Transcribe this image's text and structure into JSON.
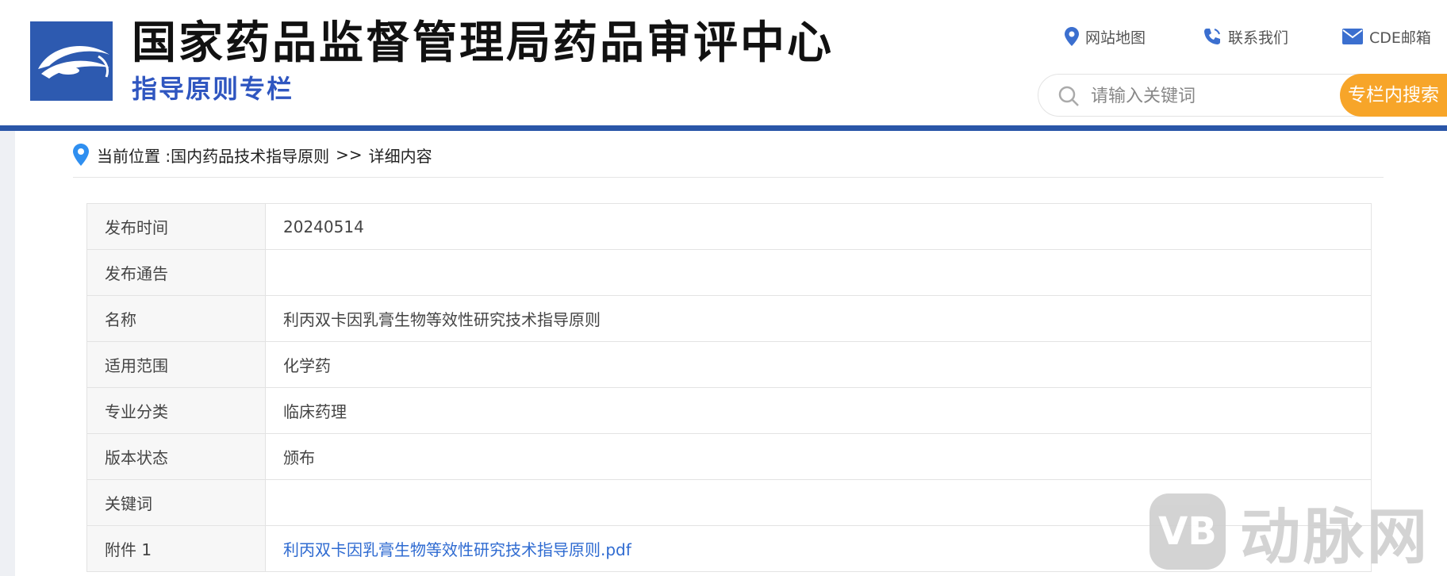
{
  "header": {
    "title": "国家药品监督管理局药品审评中心",
    "subtitle": "指导原则专栏",
    "links": [
      {
        "label": "网站地图",
        "icon": "map-pin-icon"
      },
      {
        "label": "联系我们",
        "icon": "phone-icon"
      },
      {
        "label": "CDE邮箱",
        "icon": "mail-icon"
      }
    ],
    "search": {
      "placeholder": "请输入关键词",
      "button_label": "专栏内搜索"
    }
  },
  "breadcrumb": {
    "prefix": "当前位置 : ",
    "items": [
      "国内药品技术指导原则",
      "详细内容"
    ],
    "separator": ">>"
  },
  "detail_table": [
    {
      "label": "发布时间",
      "value": "20240514"
    },
    {
      "label": "发布通告",
      "value": ""
    },
    {
      "label": "名称",
      "value": "利丙双卡因乳膏生物等效性研究技术指导原则"
    },
    {
      "label": "适用范围",
      "value": "化学药"
    },
    {
      "label": "专业分类",
      "value": "临床药理"
    },
    {
      "label": "版本状态",
      "value": "颁布"
    },
    {
      "label": "关键词",
      "value": ""
    },
    {
      "label": "附件 1",
      "value": "利丙双卡因乳膏生物等效性研究技术指导原则.pdf"
    }
  ],
  "watermark": {
    "badge": "VB",
    "text": "动脉网"
  },
  "colors": {
    "brand_blue": "#2a56a8",
    "subtitle_blue": "#2f56c0",
    "search_button": "#f7a529",
    "link_blue": "#2f6bd1",
    "icon_blue": "#3b6fcf"
  }
}
